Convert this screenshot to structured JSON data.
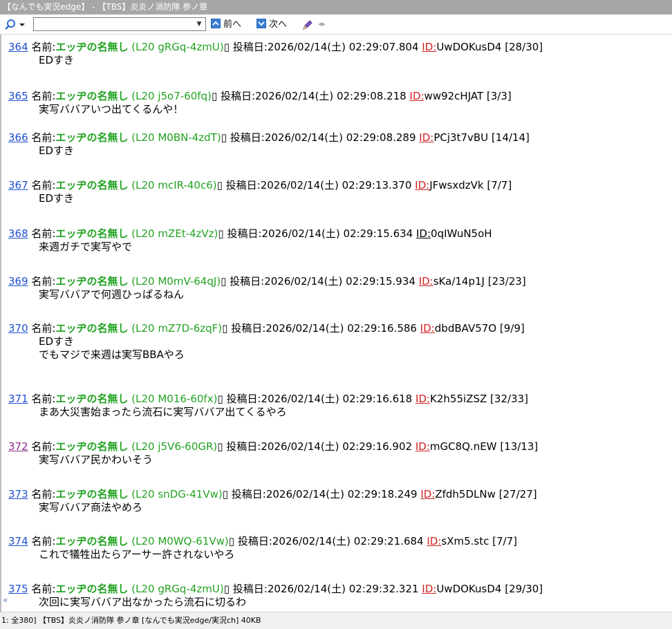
{
  "window": {
    "title": "【なんでも実況edge】 - 【TBS】炎炎ノ消防隊 参ノ章"
  },
  "toolbar": {
    "search_value": "",
    "prev_label": "前へ",
    "next_label": "次へ"
  },
  "posts": [
    {
      "num": "364",
      "name_label": "名前:",
      "name": "エッヂの名無し",
      "trip": "(L20 gRGq-4zmU)",
      "date_label": "投稿日:",
      "date": "2026/02/14(土) 02:29:07.804",
      "id_label": "ID:",
      "id": "UwDOKusD4",
      "count": "[28/30]",
      "lines": [
        "EDすき"
      ]
    },
    {
      "num": "365",
      "name_label": "名前:",
      "name": "エッヂの名無し",
      "trip": "(L20 j5o7-60fq)",
      "date_label": "投稿日:",
      "date": "2026/02/14(土) 02:29:08.218",
      "id_label": "ID:",
      "id": "ww92cHJAT",
      "count": "[3/3]",
      "lines": [
        "実写ババアいつ出てくるんや！"
      ]
    },
    {
      "num": "366",
      "name_label": "名前:",
      "name": "エッヂの名無し",
      "trip": "(L20 M0BN-4zdT)",
      "date_label": "投稿日:",
      "date": "2026/02/14(土) 02:29:08.289",
      "id_label": "ID:",
      "id": "PCj3t7vBU",
      "count": "[14/14]",
      "lines": [
        "EDすき"
      ]
    },
    {
      "num": "367",
      "name_label": "名前:",
      "name": "エッヂの名無し",
      "trip": "(L20 mcIR-40c6)",
      "date_label": "投稿日:",
      "date": "2026/02/14(土) 02:29:13.370",
      "id_label": "ID:",
      "id": "JFwsxdzVk",
      "count": "[7/7]",
      "lines": [
        "EDすき"
      ]
    },
    {
      "num": "368",
      "name_label": "名前:",
      "name": "エッヂの名無し",
      "trip": "(L20 mZEt-4zVz)",
      "date_label": "投稿日:",
      "date": "2026/02/14(土) 02:29:15.634",
      "id_label": "ID:",
      "id": "0qIWuN5oH",
      "count": "",
      "lines": [
        "来週ガチで実写やで"
      ]
    },
    {
      "num": "369",
      "name_label": "名前:",
      "name": "エッヂの名無し",
      "trip": "(L20 M0mV-64qJ)",
      "date_label": "投稿日:",
      "date": "2026/02/14(土) 02:29:15.934",
      "id_label": "ID:",
      "id": "sKa/14p1J",
      "count": "[23/23]",
      "lines": [
        "実写ババアで何週ひっぱるねん"
      ]
    },
    {
      "num": "370",
      "name_label": "名前:",
      "name": "エッヂの名無し",
      "trip": "(L20 mZ7D-6zqF)",
      "date_label": "投稿日:",
      "date": "2026/02/14(土) 02:29:16.586",
      "id_label": "ID:",
      "id": "dbdBAV57O",
      "count": "[9/9]",
      "lines": [
        "EDすき",
        "でもマジで来週は実写BBAやろ"
      ]
    },
    {
      "num": "371",
      "name_label": "名前:",
      "name": "エッヂの名無し",
      "trip": "(L20 M016-60fx)",
      "date_label": "投稿日:",
      "date": "2026/02/14(土) 02:29:16.618",
      "id_label": "ID:",
      "id": "K2h55iZSZ",
      "count": "[32/33]",
      "lines": [
        "まあ大災害始まったら流石に実写ババア出てくるやろ"
      ]
    },
    {
      "num": "372",
      "name_label": "名前:",
      "name": "エッヂの名無し",
      "trip": "(L20 j5V6-60GR)",
      "date_label": "投稿日:",
      "date": "2026/02/14(土) 02:29:16.902",
      "id_label": "ID:",
      "id": "mGC8Q.nEW",
      "count": "[13/13]",
      "lines": [
        "実写ババア民かわいそう"
      ]
    },
    {
      "num": "373",
      "name_label": "名前:",
      "name": "エッヂの名無し",
      "trip": "(L20 snDG-41Vw)",
      "date_label": "投稿日:",
      "date": "2026/02/14(土) 02:29:18.249",
      "id_label": "ID:",
      "id": "Zfdh5DLNw",
      "count": "[27/27]",
      "lines": [
        "実写ババア商法やめろ"
      ]
    },
    {
      "num": "374",
      "name_label": "名前:",
      "name": "エッヂの名無し",
      "trip": "(L20 M0WQ-61Vw)",
      "date_label": "投稿日:",
      "date": "2026/02/14(土) 02:29:21.684",
      "id_label": "ID:",
      "id": "sXm5.stc",
      "count": "[7/7]",
      "lines": [
        "これで犠牲出たらアーサー許されないやろ"
      ]
    },
    {
      "num": "375",
      "name_label": "名前:",
      "name": "エッヂの名無し",
      "trip": "(L20 gRGq-4zmU)",
      "date_label": "投稿日:",
      "date": "2026/02/14(土) 02:29:32.321",
      "id_label": "ID:",
      "id": "UwDOKusD4",
      "count": "[29/30]",
      "lines": [
        "次回に実写ババア出なかったら流石に切るわ"
      ]
    }
  ],
  "footer": {
    "back_arrow": "«",
    "status": "1: 全380] 【TBS】炎炎ノ消防隊 参ノ章 [なんでも実況edge/実況ch] 40KB"
  },
  "colors": {
    "name": "#22a322",
    "link": "#1e4fd0",
    "visited_link": "#8a2a8a",
    "id_label": "#d12020",
    "titlebar": "#a7a7a7"
  }
}
